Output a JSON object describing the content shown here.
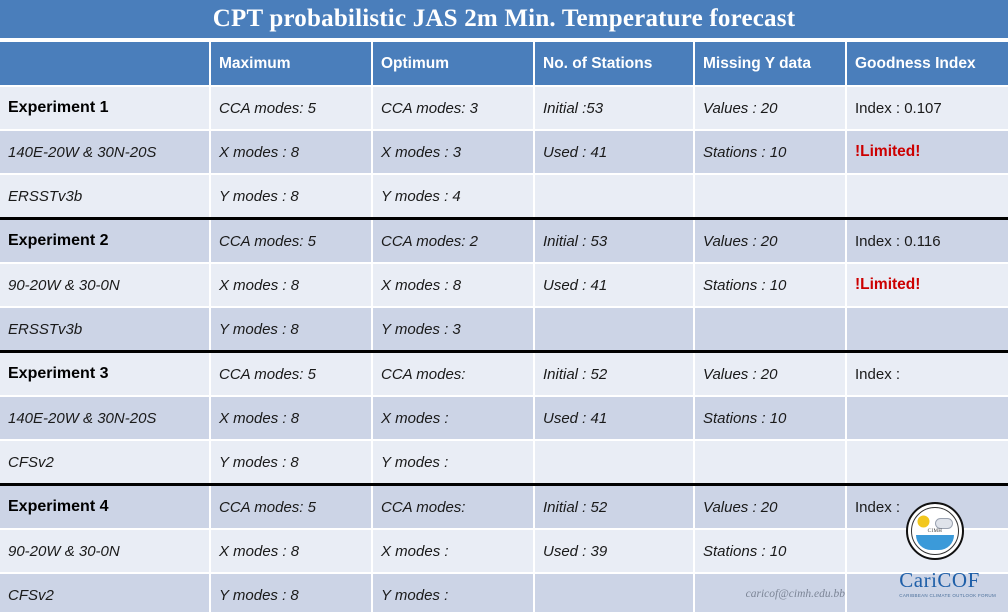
{
  "title": "CPT probabilistic JAS 2m Min. Temperature forecast",
  "columns": [
    "",
    "Maximum",
    "Optimum",
    "No. of Stations",
    "Missing Y data",
    "Goodness Index"
  ],
  "rows": [
    {
      "group": 1,
      "first": true,
      "band": "a",
      "cells": [
        "Experiment 1",
        "CCA modes: 5",
        "CCA modes: 3",
        "Initial :53",
        "Values : 20",
        "Index : 0.107"
      ],
      "styles": [
        "exp",
        "ital",
        "ital",
        "ital",
        "ital",
        "plain"
      ]
    },
    {
      "group": 1,
      "first": false,
      "band": "b",
      "cells": [
        "140E-20W & 30N-20S",
        "X modes : 8",
        "X modes : 3",
        "Used : 41",
        "Stations : 10",
        "!Limited!"
      ],
      "styles": [
        "ital",
        "ital",
        "ital",
        "ital",
        "ital",
        "limited"
      ]
    },
    {
      "group": 1,
      "first": false,
      "band": "a",
      "cells": [
        "ERSSTv3b",
        "Y modes : 8",
        "Y modes : 4",
        "",
        "",
        ""
      ],
      "styles": [
        "ital",
        "ital",
        "ital",
        "ital",
        "ital",
        "ital"
      ]
    },
    {
      "group": 2,
      "first": true,
      "band": "b",
      "cells": [
        "Experiment 2",
        "CCA modes: 5",
        "CCA modes: 2",
        "Initial : 53",
        "Values : 20",
        "Index : 0.116"
      ],
      "styles": [
        "exp",
        "ital",
        "ital",
        "ital",
        "ital",
        "plain"
      ]
    },
    {
      "group": 2,
      "first": false,
      "band": "a",
      "cells": [
        "90-20W & 30-0N",
        "X modes : 8",
        "X modes : 8",
        "Used : 41",
        "Stations : 10",
        "!Limited!"
      ],
      "styles": [
        "ital",
        "ital",
        "ital",
        "ital",
        "ital",
        "limited"
      ]
    },
    {
      "group": 2,
      "first": false,
      "band": "b",
      "cells": [
        "ERSSTv3b",
        "Y modes : 8",
        "Y modes : 3",
        "",
        "",
        ""
      ],
      "styles": [
        "ital",
        "ital",
        "ital",
        "ital",
        "ital",
        "ital"
      ]
    },
    {
      "group": 3,
      "first": true,
      "band": "a",
      "cells": [
        "Experiment 3",
        "CCA modes: 5",
        "CCA modes:",
        "Initial : 52",
        "Values : 20",
        "Index :"
      ],
      "styles": [
        "exp",
        "ital",
        "ital",
        "ital",
        "ital",
        "plain"
      ]
    },
    {
      "group": 3,
      "first": false,
      "band": "b",
      "cells": [
        "140E-20W & 30N-20S",
        "X modes : 8",
        "X modes :",
        "Used : 41",
        "Stations : 10",
        ""
      ],
      "styles": [
        "ital",
        "ital",
        "ital",
        "ital",
        "ital",
        "ital"
      ]
    },
    {
      "group": 3,
      "first": false,
      "band": "a",
      "cells": [
        "CFSv2",
        "Y modes : 8",
        "Y modes :",
        "",
        "",
        ""
      ],
      "styles": [
        "ital",
        "ital",
        "ital",
        "ital",
        "ital",
        "ital"
      ]
    },
    {
      "group": 4,
      "first": true,
      "band": "b",
      "cells": [
        "Experiment 4",
        "CCA modes: 5",
        "CCA modes:",
        "Initial : 52",
        "Values : 20",
        "Index :"
      ],
      "styles": [
        "exp",
        "ital",
        "ital",
        "ital",
        "ital",
        "plain"
      ]
    },
    {
      "group": 4,
      "first": false,
      "band": "a",
      "cells": [
        "90-20W & 30-0N",
        "X modes : 8",
        "X modes :",
        "Used : 39",
        "Stations : 10",
        ""
      ],
      "styles": [
        "ital",
        "ital",
        "ital",
        "ital",
        "ital",
        "ital"
      ]
    },
    {
      "group": 4,
      "first": false,
      "band": "b",
      "cells": [
        "CFSv2",
        "Y modes : 8",
        "Y modes :",
        "",
        "",
        ""
      ],
      "styles": [
        "ital",
        "ital",
        "ital",
        "ital",
        "ital",
        "ital"
      ]
    }
  ],
  "footer": {
    "email": "caricof@cimh.edu.bb",
    "seal_label": "CIMH",
    "logo_word": "CariCOF",
    "logo_subtitle": "CARIBBEAN CLIMATE OUTLOOK FORUM"
  },
  "colors": {
    "header_blue": "#4a7ebb",
    "band_light": "#e9edf5",
    "band_dark": "#ccd4e6",
    "limited_red": "#cc0000",
    "logo_blue": "#1f5fa8"
  }
}
